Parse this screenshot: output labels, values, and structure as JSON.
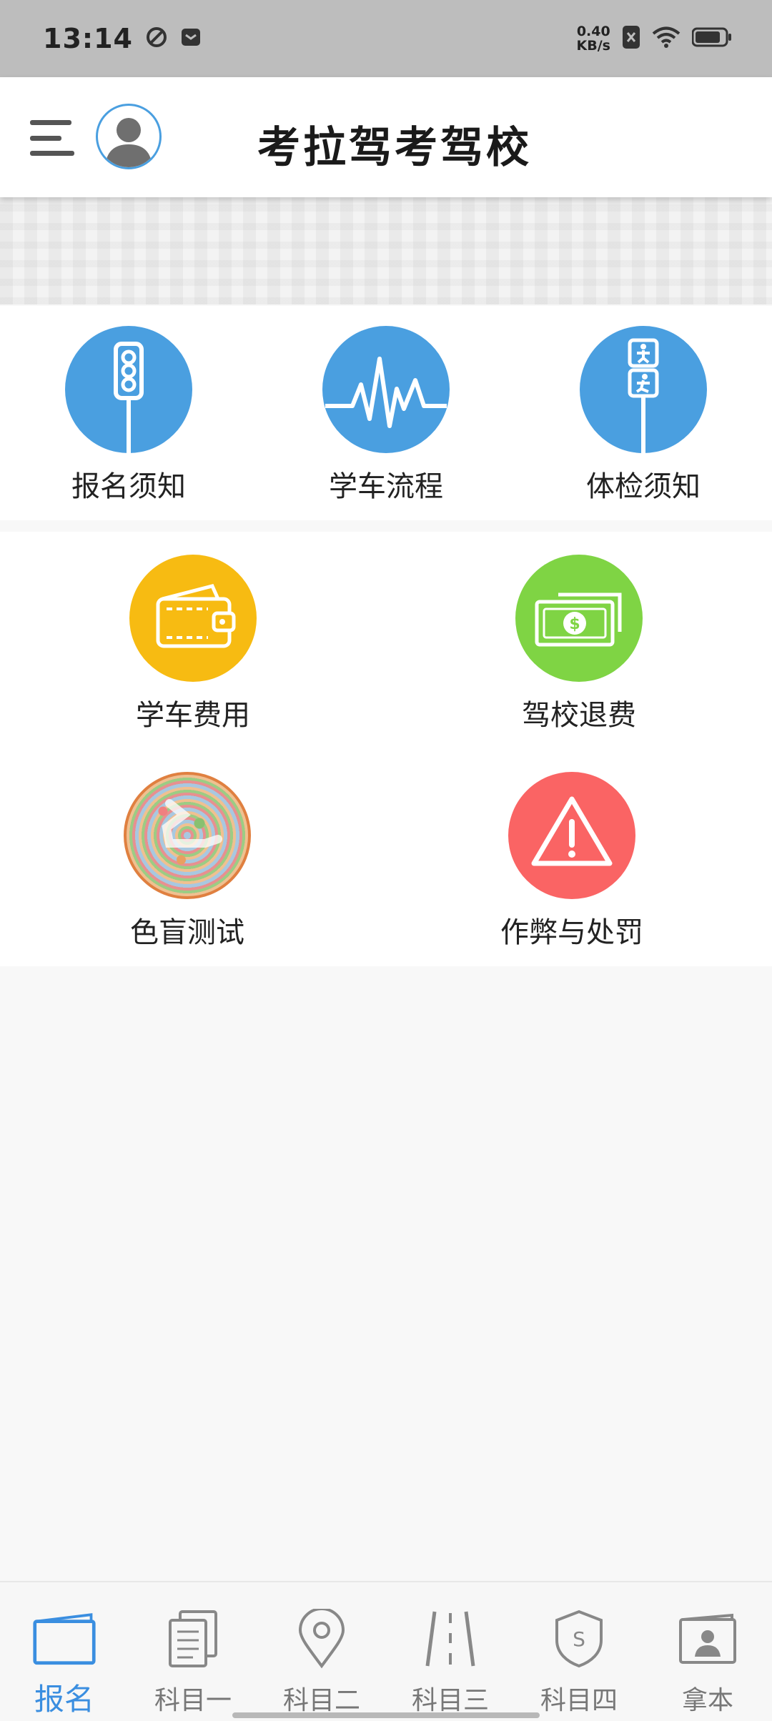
{
  "status_bar": {
    "time": "13:14",
    "net_speed_value": "0.40",
    "net_speed_unit": "KB/s",
    "battery_level": 0.85
  },
  "header": {
    "title": "考拉驾考驾校"
  },
  "grid_row_1": [
    {
      "label": "报名须知",
      "icon": "traffic-light-icon",
      "color": "#4a9fe0"
    },
    {
      "label": "学车流程",
      "icon": "pulse-line-icon",
      "color": "#4a9fe0"
    },
    {
      "label": "体检须知",
      "icon": "pedestrian-signal-icon",
      "color": "#4a9fe0"
    }
  ],
  "grid_row_2": [
    {
      "label": "学车费用",
      "icon": "wallet-icon",
      "color": "#f7bb12"
    },
    {
      "label": "驾校退费",
      "icon": "money-bill-icon",
      "color": "#7fd444"
    },
    {
      "label": "色盲测试",
      "icon": "color-blind-plate-icon",
      "color": "#e08040"
    },
    {
      "label": "作弊与处罚",
      "icon": "warning-triangle-icon",
      "color": "#fa6464"
    }
  ],
  "bottom_nav": [
    {
      "label": "报名",
      "icon": "signup-card-icon",
      "active": true
    },
    {
      "label": "科目一",
      "icon": "documents-icon",
      "active": false
    },
    {
      "label": "科目二",
      "icon": "location-pin-icon",
      "active": false
    },
    {
      "label": "科目三",
      "icon": "road-icon",
      "active": false
    },
    {
      "label": "科目四",
      "icon": "shield-s-icon",
      "active": false
    },
    {
      "label": "拿本",
      "icon": "license-card-icon",
      "active": false
    }
  ],
  "colors": {
    "accent": "#3a8ee0",
    "inactive": "#777777"
  }
}
